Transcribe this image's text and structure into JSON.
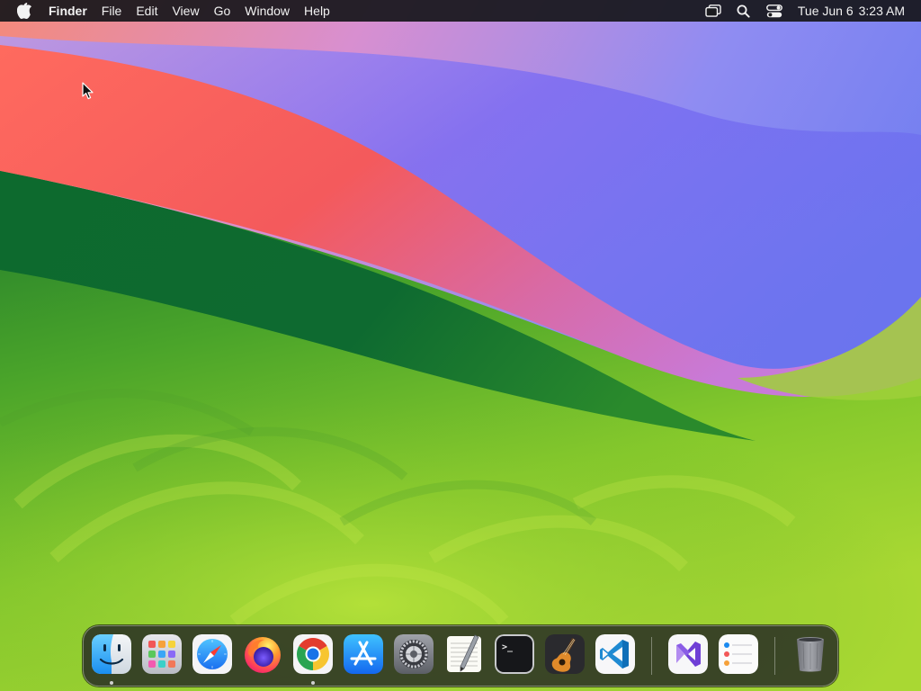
{
  "menubar": {
    "app_name": "Finder",
    "menus": [
      "File",
      "Edit",
      "View",
      "Go",
      "Window",
      "Help"
    ],
    "clock": {
      "date": "Tue Jun 6",
      "time": "3:23 AM"
    },
    "icons": [
      "apple-icon",
      "screen-mirroring-icon",
      "spotlight-search-icon",
      "control-center-icon"
    ]
  },
  "dock": {
    "apps": [
      {
        "name": "finder",
        "icon": "finder-icon",
        "running": true
      },
      {
        "name": "launchpad",
        "icon": "launchpad-icon",
        "running": false
      },
      {
        "name": "safari",
        "icon": "safari-icon",
        "running": false
      },
      {
        "name": "firefox",
        "icon": "firefox-icon",
        "running": false
      },
      {
        "name": "chrome",
        "icon": "chrome-icon",
        "running": true
      },
      {
        "name": "app-store",
        "icon": "app-store-icon",
        "running": false
      },
      {
        "name": "system-settings",
        "icon": "system-settings-icon",
        "running": false
      },
      {
        "name": "textedit",
        "icon": "textedit-icon",
        "running": false
      },
      {
        "name": "terminal",
        "icon": "terminal-icon",
        "running": false
      },
      {
        "name": "garageband",
        "icon": "garageband-icon",
        "running": false
      },
      {
        "name": "vscode",
        "icon": "vscode-icon",
        "running": false
      },
      {
        "name": "visual-studio",
        "icon": "visual-studio-icon",
        "running": false
      },
      {
        "name": "reminders",
        "icon": "reminders-icon",
        "running": false
      },
      {
        "name": "trash",
        "icon": "trash-icon",
        "running": false
      }
    ],
    "terminal_prompt": ">_"
  },
  "colors": {
    "menubar_bg": "#16161a",
    "wallpaper_green": "#7cc62f",
    "wallpaper_red": "#f25a5a",
    "wallpaper_violet": "#7d76f0"
  }
}
